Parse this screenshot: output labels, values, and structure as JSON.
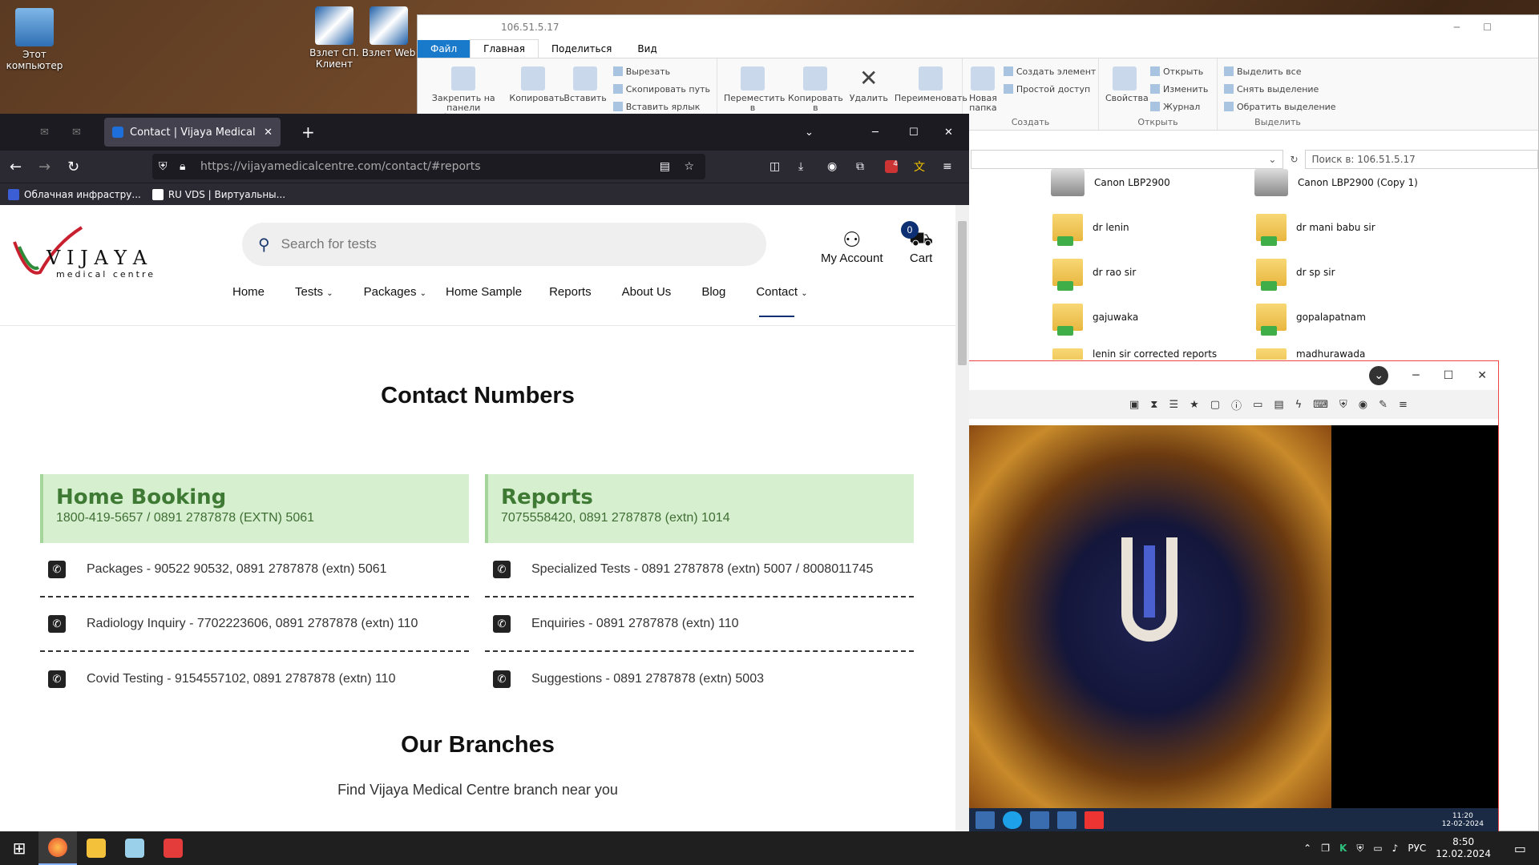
{
  "desktop": {
    "icons": [
      {
        "label": "Этот компьютер"
      },
      {
        "label": "Взлет СП. Клиент"
      },
      {
        "label": "Взлет Web"
      }
    ]
  },
  "explorer": {
    "title": "106.51.5.17",
    "tabs": [
      "Файл",
      "Главная",
      "Поделиться",
      "Вид"
    ],
    "ribbon": {
      "pin": "Закрепить на панели быстрого доступа",
      "copy": "Копировать",
      "paste": "Вставить",
      "cut": "Вырезать",
      "copy_path": "Скопировать путь",
      "paste_shortcut": "Вставить ярлык",
      "move_to": "Переместить в",
      "copy_to": "Копировать в",
      "delete": "Удалить",
      "rename": "Переименовать",
      "new_folder": "Новая папка",
      "new_item": "Создать элемент",
      "easy_access": "Простой доступ",
      "group_create": "Создать",
      "properties": "Свойства",
      "open": "Открыть",
      "edit": "Изменить",
      "history": "Журнал",
      "group_open": "Открыть",
      "select_all": "Выделить все",
      "select_none": "Снять выделение",
      "invert": "Обратить выделение",
      "group_select": "Выделить"
    },
    "search_placeholder": "Поиск в: 106.51.5.17",
    "items": [
      {
        "name": "Canon LBP2900",
        "kind": "printer"
      },
      {
        "name": "Canon LBP2900 (Copy 1)",
        "kind": "printer"
      },
      {
        "name": "dr lenin",
        "kind": "folder"
      },
      {
        "name": "dr mani babu sir",
        "kind": "folder"
      },
      {
        "name": "dr rao sir",
        "kind": "folder"
      },
      {
        "name": "dr sp sir",
        "kind": "folder"
      },
      {
        "name": "gajuwaka",
        "kind": "folder"
      },
      {
        "name": "gopalapatnam",
        "kind": "folder"
      },
      {
        "name": "lenin sir corrected reports",
        "kind": "folder"
      },
      {
        "name": "madhurawada",
        "kind": "folder"
      }
    ]
  },
  "browser": {
    "tab_title": "Contact | Vijaya Medical Centre",
    "url_host": "https://vijayamedicalcentre.com",
    "url_path": "/contact/#reports",
    "bookmarks": [
      "Облачная инфрастру...",
      "RU VDS | Виртуальны..."
    ],
    "ext_badge": "4"
  },
  "site": {
    "logo_text": "V I J A Y A",
    "logo_sub": "medical centre",
    "search_placeholder": "Search for tests",
    "my_account": "My Account",
    "cart": "Cart",
    "cart_count": "0",
    "menu": [
      "Home",
      "Tests",
      "Packages",
      "Home Sample",
      "Reports",
      "About Us",
      "Blog",
      "Contact"
    ],
    "contact_title": "Contact Numbers",
    "cards": [
      {
        "title": "Home Booking",
        "number": "1800-419-5657 / 0891 2787878 (EXTN) 5061",
        "rows": [
          "Packages - 90522 90532, 0891 2787878 (extn) 5061",
          "Radiology Inquiry - 7702223606, 0891 2787878 (extn) 110",
          "Covid Testing - 9154557102, 0891 2787878 (extn) 110"
        ]
      },
      {
        "title": "Reports",
        "number": "7075558420, 0891 2787878 (extn) 1014",
        "rows": [
          "Specialized Tests - 0891 2787878 (extn) 5007 / 8008011745",
          "Enquiries - 0891 2787878 (extn) 110",
          "Suggestions - 0891 2787878 (extn) 5003"
        ]
      }
    ],
    "branches_title": "Our Branches",
    "branches_sub": "Find Vijaya Medical Centre branch near you"
  },
  "viewer": {
    "inner_clock_time": "11:20",
    "inner_clock_date": "12-02-2024"
  },
  "taskbar": {
    "lang": "РУС",
    "time": "8:50",
    "date": "12.02.2024"
  },
  "colors": {
    "card_bg": "#d6f0cf",
    "card_title": "#3f7a34",
    "browser_dark": "#1c1b22",
    "explorer_blue": "#1979ca"
  }
}
